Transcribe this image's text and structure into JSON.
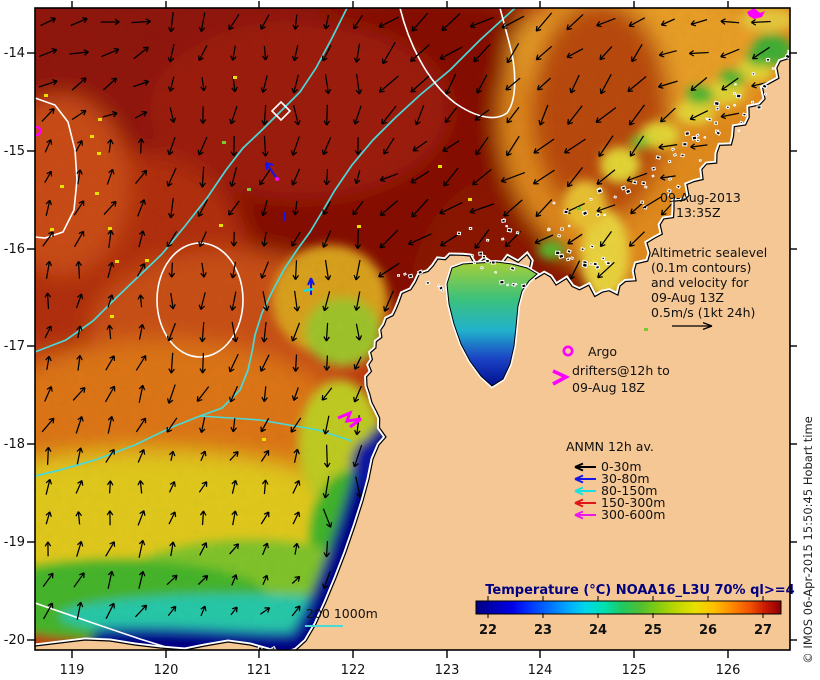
{
  "frame": {
    "copyright": "© IMOS 06-Apr-2015 15:50:45 Hobart time"
  },
  "timestamp": {
    "line1": "09-Aug-2013",
    "line2": "13:35Z"
  },
  "altimetric_note": {
    "line1": "Altimetric sealevel",
    "line2": "(0.1m contours)",
    "line3": "and velocity for",
    "line4": "09-Aug 13Z",
    "line5": "0.5m/s (1kt 24h)"
  },
  "argo": {
    "label": "Argo",
    "marker_color": "#ff00ff"
  },
  "drifters": {
    "line1": "drifters@12h to",
    "line2": "09-Aug 18Z",
    "marker_color": "#ff00ff"
  },
  "anmn": {
    "title": "ANMN 12h av.",
    "entries": [
      {
        "label": "0-30m",
        "color": "#000000"
      },
      {
        "label": "30-80m",
        "color": "#1515e8"
      },
      {
        "label": "80-150m",
        "color": "#15e0e0"
      },
      {
        "label": "150-300m",
        "color": "#e01515"
      },
      {
        "label": "300-600m",
        "color": "#ee15ee"
      }
    ]
  },
  "isobath_scale": {
    "label": "200 1000m",
    "line_color": "#4ad9d9"
  },
  "colorbar": {
    "title": "Temperature (°C) NOAA16_L3U 70% ql>=4",
    "title_color": "#000080",
    "ticks": [
      "22",
      "23",
      "24",
      "25",
      "26",
      "27"
    ]
  },
  "axes": {
    "x_ticks": [
      "119",
      "120",
      "121",
      "122",
      "123",
      "124",
      "125",
      "126"
    ],
    "y_ticks": [
      "-14",
      "-15",
      "-16",
      "-17",
      "-18",
      "-19",
      "-20"
    ]
  },
  "map": {
    "land_color": "#f5c795",
    "contour_sealevel_color": "#ffffff",
    "contour_isobath_color": "#4ad9d9",
    "arrow_color": "#000000",
    "sst_hot_color": "#8a1404",
    "sst_cold_color": "#000080"
  }
}
